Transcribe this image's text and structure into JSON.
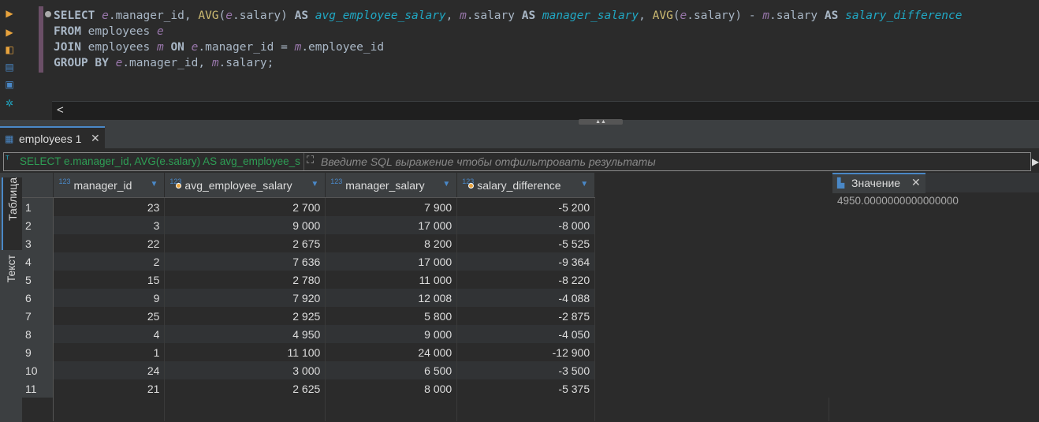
{
  "editor": {
    "lines": [
      [
        {
          "t": "SELECT ",
          "c": "kw2"
        },
        {
          "t": "e",
          "c": "al"
        },
        {
          "t": ".manager_id, ",
          "c": "id"
        },
        {
          "t": "AVG",
          "c": "fn"
        },
        {
          "t": "(",
          "c": "id"
        },
        {
          "t": "e",
          "c": "al"
        },
        {
          "t": ".salary) ",
          "c": "id"
        },
        {
          "t": "AS ",
          "c": "kw2"
        },
        {
          "t": "avg_employee_salary",
          "c": "cyan"
        },
        {
          "t": ", ",
          "c": "id"
        },
        {
          "t": "m",
          "c": "al"
        },
        {
          "t": ".salary ",
          "c": "id"
        },
        {
          "t": "AS ",
          "c": "kw2"
        },
        {
          "t": "manager_salary",
          "c": "cyan"
        },
        {
          "t": ", ",
          "c": "id"
        },
        {
          "t": "AVG",
          "c": "fn"
        },
        {
          "t": "(",
          "c": "id"
        },
        {
          "t": "e",
          "c": "al"
        },
        {
          "t": ".salary) - ",
          "c": "id"
        },
        {
          "t": "m",
          "c": "al"
        },
        {
          "t": ".salary ",
          "c": "id"
        },
        {
          "t": "AS ",
          "c": "kw2"
        },
        {
          "t": "salary_difference",
          "c": "cyan"
        }
      ],
      [
        {
          "t": "FROM ",
          "c": "kw2"
        },
        {
          "t": "employees ",
          "c": "id"
        },
        {
          "t": "e",
          "c": "al"
        }
      ],
      [
        {
          "t": "JOIN ",
          "c": "kw2"
        },
        {
          "t": "employees ",
          "c": "id"
        },
        {
          "t": "m ",
          "c": "al"
        },
        {
          "t": "ON ",
          "c": "kw2"
        },
        {
          "t": "e",
          "c": "al"
        },
        {
          "t": ".manager_id = ",
          "c": "id"
        },
        {
          "t": "m",
          "c": "al"
        },
        {
          "t": ".employee_id",
          "c": "id"
        }
      ],
      [
        {
          "t": "GROUP BY ",
          "c": "kw2"
        },
        {
          "t": "e",
          "c": "al"
        },
        {
          "t": ".manager_id, ",
          "c": "id"
        },
        {
          "t": "m",
          "c": "al"
        },
        {
          "t": ".salary;",
          "c": "id"
        }
      ]
    ],
    "scroll_left_glyph": "<"
  },
  "results_tab": {
    "label": "employees 1",
    "close": "✕"
  },
  "filter": {
    "sql": "SELECT e.manager_id, AVG(e.salary) AS avg_employee_salary",
    "placeholder": "Введите SQL выражение чтобы отфильтровать результаты"
  },
  "side_tabs": {
    "table": "Таблица",
    "text": "Текст"
  },
  "grid": {
    "type_badge": "123",
    "columns": [
      {
        "name": "manager_id",
        "icon": "type-number"
      },
      {
        "name": "avg_employee_salary",
        "icon": "computed"
      },
      {
        "name": "manager_salary",
        "icon": "type-number"
      },
      {
        "name": "salary_difference",
        "icon": "computed"
      }
    ],
    "rows": [
      [
        "1",
        "23",
        "2 700",
        "7 900",
        "-5 200"
      ],
      [
        "2",
        "3",
        "9 000",
        "17 000",
        "-8 000"
      ],
      [
        "3",
        "22",
        "2 675",
        "8 200",
        "-5 525"
      ],
      [
        "4",
        "2",
        "7 636",
        "17 000",
        "-9 364"
      ],
      [
        "5",
        "15",
        "2 780",
        "11 000",
        "-8 220"
      ],
      [
        "6",
        "9",
        "7 920",
        "12 008",
        "-4 088"
      ],
      [
        "7",
        "25",
        "2 925",
        "5 800",
        "-2 875"
      ],
      [
        "8",
        "4",
        "4 950",
        "9 000",
        "-4 050"
      ],
      [
        "9",
        "1",
        "11 100",
        "24 000",
        "-12 900"
      ],
      [
        "10",
        "24",
        "3 000",
        "6 500",
        "-3 500"
      ],
      [
        "11",
        "21",
        "2 625",
        "8 000",
        "-5 375"
      ]
    ]
  },
  "value_panel": {
    "title": "Значение",
    "close": "✕",
    "value": "4950.0000000000000000"
  }
}
